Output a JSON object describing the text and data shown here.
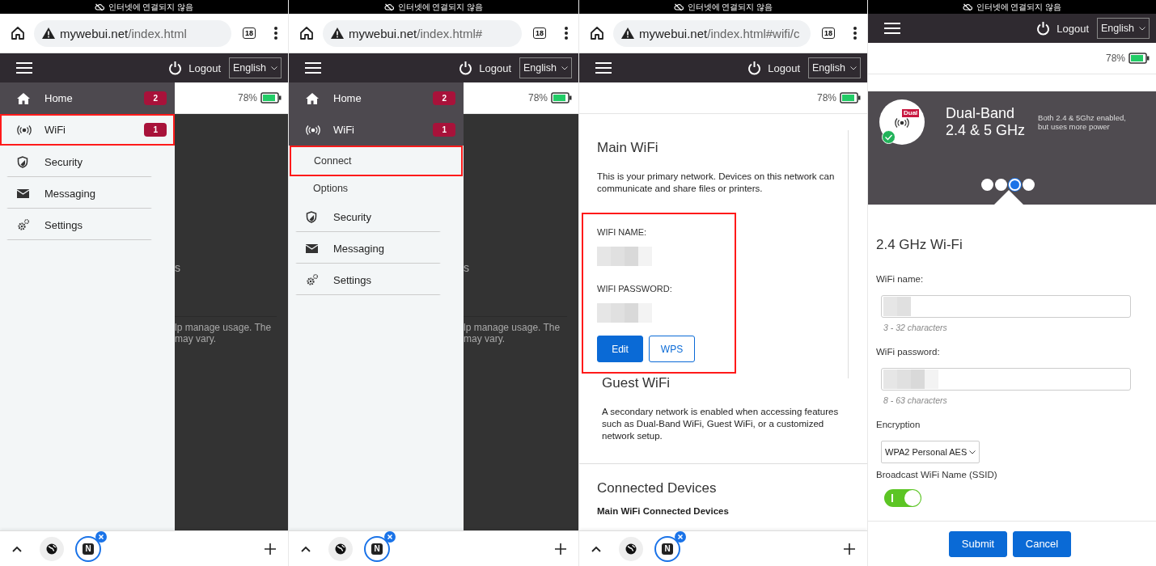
{
  "screens": [
    {
      "kind": "menu",
      "status_text": "인터넷에 연결되지 않음",
      "url": {
        "host": "mywebui.net",
        "path": "/index.html"
      },
      "tab_count": "18",
      "header": {
        "logout": "Logout",
        "language": "English"
      },
      "battery": "78%",
      "menu": [
        {
          "label": "Home",
          "badge": "2",
          "selected": true,
          "highlighted": false
        },
        {
          "label": "WiFi",
          "badge": "1",
          "selected": false,
          "highlighted": true
        },
        {
          "label": "Security",
          "selected": false,
          "highlighted": false
        },
        {
          "label": "Messaging",
          "selected": false,
          "highlighted": false
        },
        {
          "label": "Settings",
          "selected": false,
          "highlighted": false
        }
      ],
      "backdrop": {
        "heading_fragment": "s",
        "lines": [
          "lp manage usage. The",
          "may vary."
        ]
      },
      "toolbar": {
        "app_letter": "N"
      }
    },
    {
      "kind": "menu",
      "status_text": "인터넷에 연결되지 않음",
      "url": {
        "host": "mywebui.net",
        "path": "/index.html#"
      },
      "tab_count": "18",
      "header": {
        "logout": "Logout",
        "language": "English"
      },
      "battery": "78%",
      "menu": [
        {
          "label": "Home",
          "badge": "2",
          "selected": true,
          "highlighted": false
        },
        {
          "label": "WiFi",
          "badge": "1",
          "selected": true,
          "highlighted": false,
          "children": [
            {
              "label": "Connect",
              "highlighted": true
            },
            {
              "label": "Options",
              "highlighted": false
            }
          ]
        },
        {
          "label": "Security",
          "selected": false,
          "highlighted": false
        },
        {
          "label": "Messaging",
          "selected": false,
          "highlighted": false
        },
        {
          "label": "Settings",
          "selected": false,
          "highlighted": false
        }
      ],
      "backdrop": {
        "heading_fragment": "s",
        "lines": [
          "lp manage usage. The",
          "may vary."
        ]
      },
      "toolbar": {
        "app_letter": "N"
      }
    },
    {
      "kind": "wifi",
      "status_text": "인터넷에 연결되지 않음",
      "url": {
        "host": "mywebui.net",
        "path": "/index.html#wifi/c"
      },
      "tab_count": "18",
      "header": {
        "logout": "Logout",
        "language": "English"
      },
      "battery": "78%",
      "main_wifi": {
        "title": "Main WiFi",
        "description": "This is your primary network. Devices on this network can communicate and share files or printers.",
        "highlighted": true,
        "name_label": "WIFI NAME:",
        "password_label": "WIFI PASSWORD:",
        "buttons": [
          {
            "label": "Edit",
            "kind": "primary"
          },
          {
            "label": "WPS",
            "kind": "secondary"
          }
        ]
      },
      "guest_wifi": {
        "title": "Guest WiFi",
        "description": "A secondary network is enabled when accessing features such as Dual-Band WiFi, Guest WiFi, or a customized network setup."
      },
      "connected_devices": {
        "title": "Connected Devices",
        "subtitle": "Main WiFi Connected Devices"
      },
      "toolbar": {
        "app_letter": "N"
      }
    },
    {
      "kind": "settings",
      "status_text": "인터넷에 연결되지 않음",
      "header": {
        "logout": "Logout",
        "language": "English"
      },
      "battery": "78%",
      "carousel": {
        "icon_tag": "Dual",
        "active": true,
        "title": "Dual-Band\n2.4 & 5 GHz",
        "description": "Both 2.4 & 5Ghz enabled, but uses more power",
        "pages": [
          {
            "selected": false
          },
          {
            "selected": false
          },
          {
            "selected": true
          },
          {
            "selected": false
          }
        ]
      },
      "form": {
        "title": "2.4 GHz Wi-Fi",
        "name_label": "WiFi name:",
        "name_hint": "3 - 32 characters",
        "password_label": "WiFi password:",
        "password_hint": "8 - 63 characters",
        "encryption_label": "Encryption",
        "encryption": "WPA2 Personal AES",
        "broadcast_label": "Broadcast WiFi Name (SSID)",
        "broadcast_on": true
      },
      "buttons": [
        {
          "label": "Submit"
        },
        {
          "label": "Cancel"
        }
      ]
    }
  ]
}
